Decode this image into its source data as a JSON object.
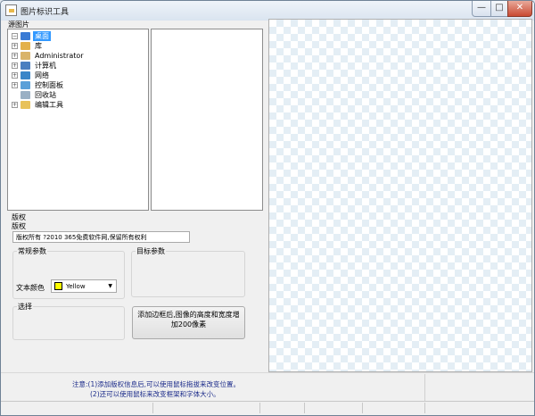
{
  "window": {
    "title": "图片标识工具"
  },
  "caption_buttons": {
    "minimize": "—",
    "maximize": "□",
    "close": "✕"
  },
  "source": {
    "label": "源图片",
    "tree": [
      {
        "label": "桌面",
        "icon": "desktop-icon",
        "color": "#3a7bd5",
        "expander": "−",
        "selected": true
      },
      {
        "label": "库",
        "icon": "library-icon",
        "color": "#e3b14a",
        "expander": "+"
      },
      {
        "label": "Administrator",
        "icon": "user-folder-icon",
        "color": "#d9b46a",
        "expander": "+"
      },
      {
        "label": "计算机",
        "icon": "computer-icon",
        "color": "#4a7fc0",
        "expander": "+"
      },
      {
        "label": "网络",
        "icon": "network-icon",
        "color": "#3a86c8",
        "expander": "+"
      },
      {
        "label": "控制面板",
        "icon": "control-panel-icon",
        "color": "#5aa0d8",
        "expander": "+"
      },
      {
        "label": "回收站",
        "icon": "recycle-bin-icon",
        "color": "#9ab0c4",
        "expander": ""
      },
      {
        "label": "编辑工具",
        "icon": "folder-icon",
        "color": "#e8c25a",
        "expander": "+"
      }
    ]
  },
  "copyright": {
    "section_label": "版权",
    "field_label": "版权",
    "text_value": "版权所有 ?2010 365免费软件网,保留所有权利"
  },
  "common_params": {
    "title": "常规参数",
    "color_label": "文本颜色",
    "color_value": "Yellow",
    "color_hex": "#ffff00"
  },
  "target_params": {
    "title": "目标参数"
  },
  "select_group": {
    "title": "选择"
  },
  "border_button": {
    "line1": "添加边框后,图像的高度和宽度增",
    "line2": "加200像素"
  },
  "notice": {
    "line1": "注意:(1)添加版权信息后,可以使用鼠标拖拔来改变位置。",
    "line2": "(2)还可以使用鼠标来改变框架和字体大小。"
  }
}
